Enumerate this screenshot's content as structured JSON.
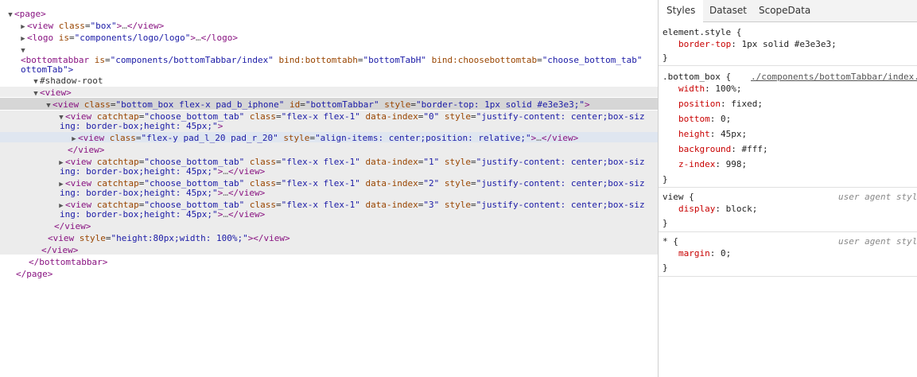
{
  "elements_tree": {
    "page_open": "<page>",
    "view_box": {
      "open": "<view",
      "attr": "class",
      "value": "\"box\"",
      "close": "></view>"
    },
    "logo": {
      "open": "<logo",
      "attr": "is",
      "value": "\"components/logo/logo\"",
      "close": "></logo>"
    },
    "bottomtabbar": {
      "open": "<bottomtabbar",
      "attr1": "is",
      "value1": "\"components/bottomTabbar/index\"",
      "attr2": "bind:bottomtabh",
      "value2": "\"bottomTabH\"",
      "attr3": "bind:choosebottomtab",
      "value3": "\"choose_bottom_tab\"",
      "wrap": "ottomTab\">"
    },
    "shadow_root": "#shadow-root",
    "view_open": "<view>",
    "bottom_box": {
      "open": "<view",
      "attr_class": "class",
      "val_class": "\"bottom_box flex-x pad_b_iphone\"",
      "attr_id": "id",
      "val_id": "\"bottomTabbar\"",
      "attr_style": "style",
      "val_style": "\"border-top: 1px solid #e3e3e3;\"",
      "close": ">"
    },
    "item0": {
      "open": "<view",
      "attr_tap": "catchtap",
      "val_tap": "\"choose_bottom_tab\"",
      "attr_class": "class",
      "val_class": "\"flex-x flex-1\"",
      "attr_idx": "data-index",
      "val_idx": "\"0\"",
      "attr_style": "style",
      "val_style": "\"justify-content: center;box-siz",
      "wrap": "ing: border-box;height: 45px;\"",
      "close": ">"
    },
    "inner_view": {
      "open": "<view",
      "attr_class": "class",
      "val_class": "\"flex-y pad_l_20 pad_r_20\"",
      "attr_style": "style",
      "val_style": "\"align-items: center;position: relative;\"",
      "close": "></view>"
    },
    "view_close": "</view>",
    "item1": {
      "val_idx": "\"1\""
    },
    "item2": {
      "val_idx": "\"2\""
    },
    "item3": {
      "val_idx": "\"3\""
    },
    "item_common": {
      "open": "<view",
      "attr_tap": "catchtap",
      "val_tap": "\"choose_bottom_tab\"",
      "attr_class": "class",
      "val_class": "\"flex-x flex-1\"",
      "attr_idx": "data-index",
      "attr_style": "style",
      "val_style": "\"justify-content: center;box-siz",
      "wrap": "ing: border-box;height: 45px;\"",
      "close": "></view>"
    },
    "spacer_view": {
      "open": "<view",
      "attr_style": "style",
      "val_style": "\"height:80px;width: 100%;\"",
      "close": "></view>"
    },
    "bottomtabbar_close": "</bottomtabbar>",
    "page_close": "</page>",
    "ellipsis": "…"
  },
  "side_panel": {
    "tabs": [
      "Styles",
      "Dataset",
      "ScopeData"
    ],
    "rules": [
      {
        "selector": "element.style {",
        "source": "",
        "props": [
          {
            "name": "border-top",
            "value": "1px solid #e3e3e3;"
          }
        ]
      },
      {
        "selector": ".bottom_box {",
        "source": "./components/bottomTabbar/index.",
        "props": [
          {
            "name": "width",
            "value": "100%;"
          },
          {
            "name": "position",
            "value": "fixed;"
          },
          {
            "name": "bottom",
            "value": "0;"
          },
          {
            "name": "height",
            "value": "45px;"
          },
          {
            "name": "background",
            "value": "#fff;"
          },
          {
            "name": "z-index",
            "value": "998;"
          }
        ]
      },
      {
        "selector": "view {",
        "source": "user agent styl",
        "props": [
          {
            "name": "display",
            "value": "block;"
          }
        ]
      },
      {
        "selector": "* {",
        "source": "user agent styl",
        "props": [
          {
            "name": "margin",
            "value": "0;"
          }
        ]
      }
    ],
    "closing_brace": "}"
  }
}
